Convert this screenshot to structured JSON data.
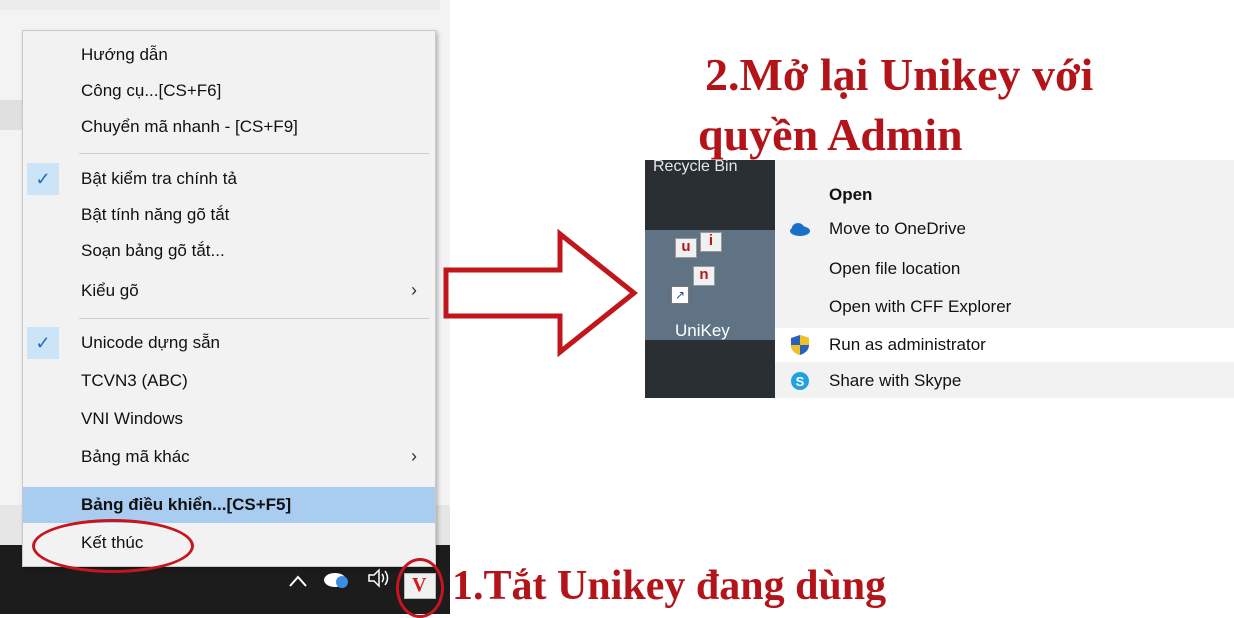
{
  "unikey_menu": {
    "items": [
      {
        "label": "Hướng dẫn"
      },
      {
        "label": "Công cụ...[CS+F6]"
      },
      {
        "label": "Chuyển mã nhanh - [CS+F9]"
      },
      {
        "label": "Bật kiểm tra chính tả",
        "checked": true
      },
      {
        "label": "Bật tính năng gõ tắt"
      },
      {
        "label": "Soạn bảng gõ tắt..."
      },
      {
        "label": "Kiểu gõ",
        "submenu": true
      },
      {
        "label": "Unicode dựng sẵn",
        "checked": true
      },
      {
        "label": "TCVN3 (ABC)"
      },
      {
        "label": "VNI Windows"
      },
      {
        "label": "Bảng mã khác",
        "submenu": true
      },
      {
        "label": "Bảng điều khiển...[CS+F5]",
        "highlighted": true
      },
      {
        "label": "Kết thúc"
      }
    ],
    "check_glyph": "✓",
    "submenu_glyph": "›"
  },
  "taskbar": {
    "chevron_icon": "chevron-up-icon",
    "onedrive_icon": "onedrive-icon",
    "volume_icon": "volume-icon",
    "unikey_tray_letter": "V"
  },
  "annotations": {
    "step1": "1.Tắt Unikey đang dùng",
    "step2_line1": "2.Mở lại Unikey với",
    "step2_line2": "quyền Admin",
    "color": "#b31419"
  },
  "desktop": {
    "recycle_bin_label": "Recycle Bin",
    "unikey_label": "UniKey",
    "keys": [
      "u",
      "i",
      "n"
    ]
  },
  "explorer_menu": {
    "items": [
      {
        "label": "Open",
        "bold": true,
        "icon": ""
      },
      {
        "label": "Move to OneDrive",
        "icon": "onedrive-icon"
      },
      {
        "label": "Open file location",
        "icon": ""
      },
      {
        "label": "Open with CFF Explorer",
        "icon": ""
      },
      {
        "label": "Run as administrator",
        "icon": "uac-shield-icon",
        "hover": true
      },
      {
        "label": "Share with Skype",
        "icon": "skype-icon"
      }
    ]
  }
}
